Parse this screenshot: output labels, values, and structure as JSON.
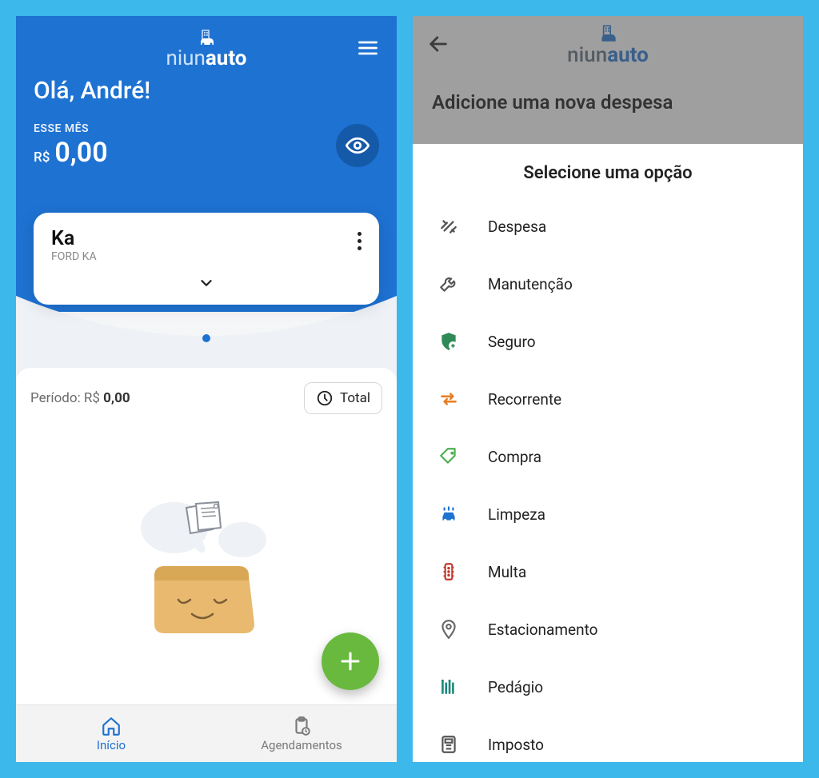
{
  "logo": {
    "prefix": "niun",
    "suffix": "auto"
  },
  "left": {
    "greeting": "Olá, André!",
    "month_label": "ESSE MÊS",
    "currency": "R$",
    "amount": "0,00",
    "car_name": "Ka",
    "car_sub": "FORD KA",
    "period_label": "Período: R$ ",
    "period_value": "0,00",
    "total_chip": "Total",
    "nav_home": "Início",
    "nav_sched": "Agendamentos"
  },
  "right": {
    "page_title": "Adicione uma nova despesa",
    "sheet_title": "Selecione uma opção",
    "options": [
      {
        "label": "Despesa",
        "icon": "expense",
        "color": "#555"
      },
      {
        "label": "Manutenção",
        "icon": "wrench",
        "color": "#555"
      },
      {
        "label": "Seguro",
        "icon": "shield",
        "color": "#2e8b57"
      },
      {
        "label": "Recorrente",
        "icon": "repeat",
        "color": "#e67e22"
      },
      {
        "label": "Compra",
        "icon": "tag",
        "color": "#4caf50"
      },
      {
        "label": "Limpeza",
        "icon": "carwash",
        "color": "#1e72d2"
      },
      {
        "label": "Multa",
        "icon": "traffic",
        "color": "#c0392b"
      },
      {
        "label": "Estacionamento",
        "icon": "pin",
        "color": "#666"
      },
      {
        "label": "Pedágio",
        "icon": "toll",
        "color": "#1a8a7a"
      },
      {
        "label": "Imposto",
        "icon": "tax",
        "color": "#555"
      }
    ]
  }
}
